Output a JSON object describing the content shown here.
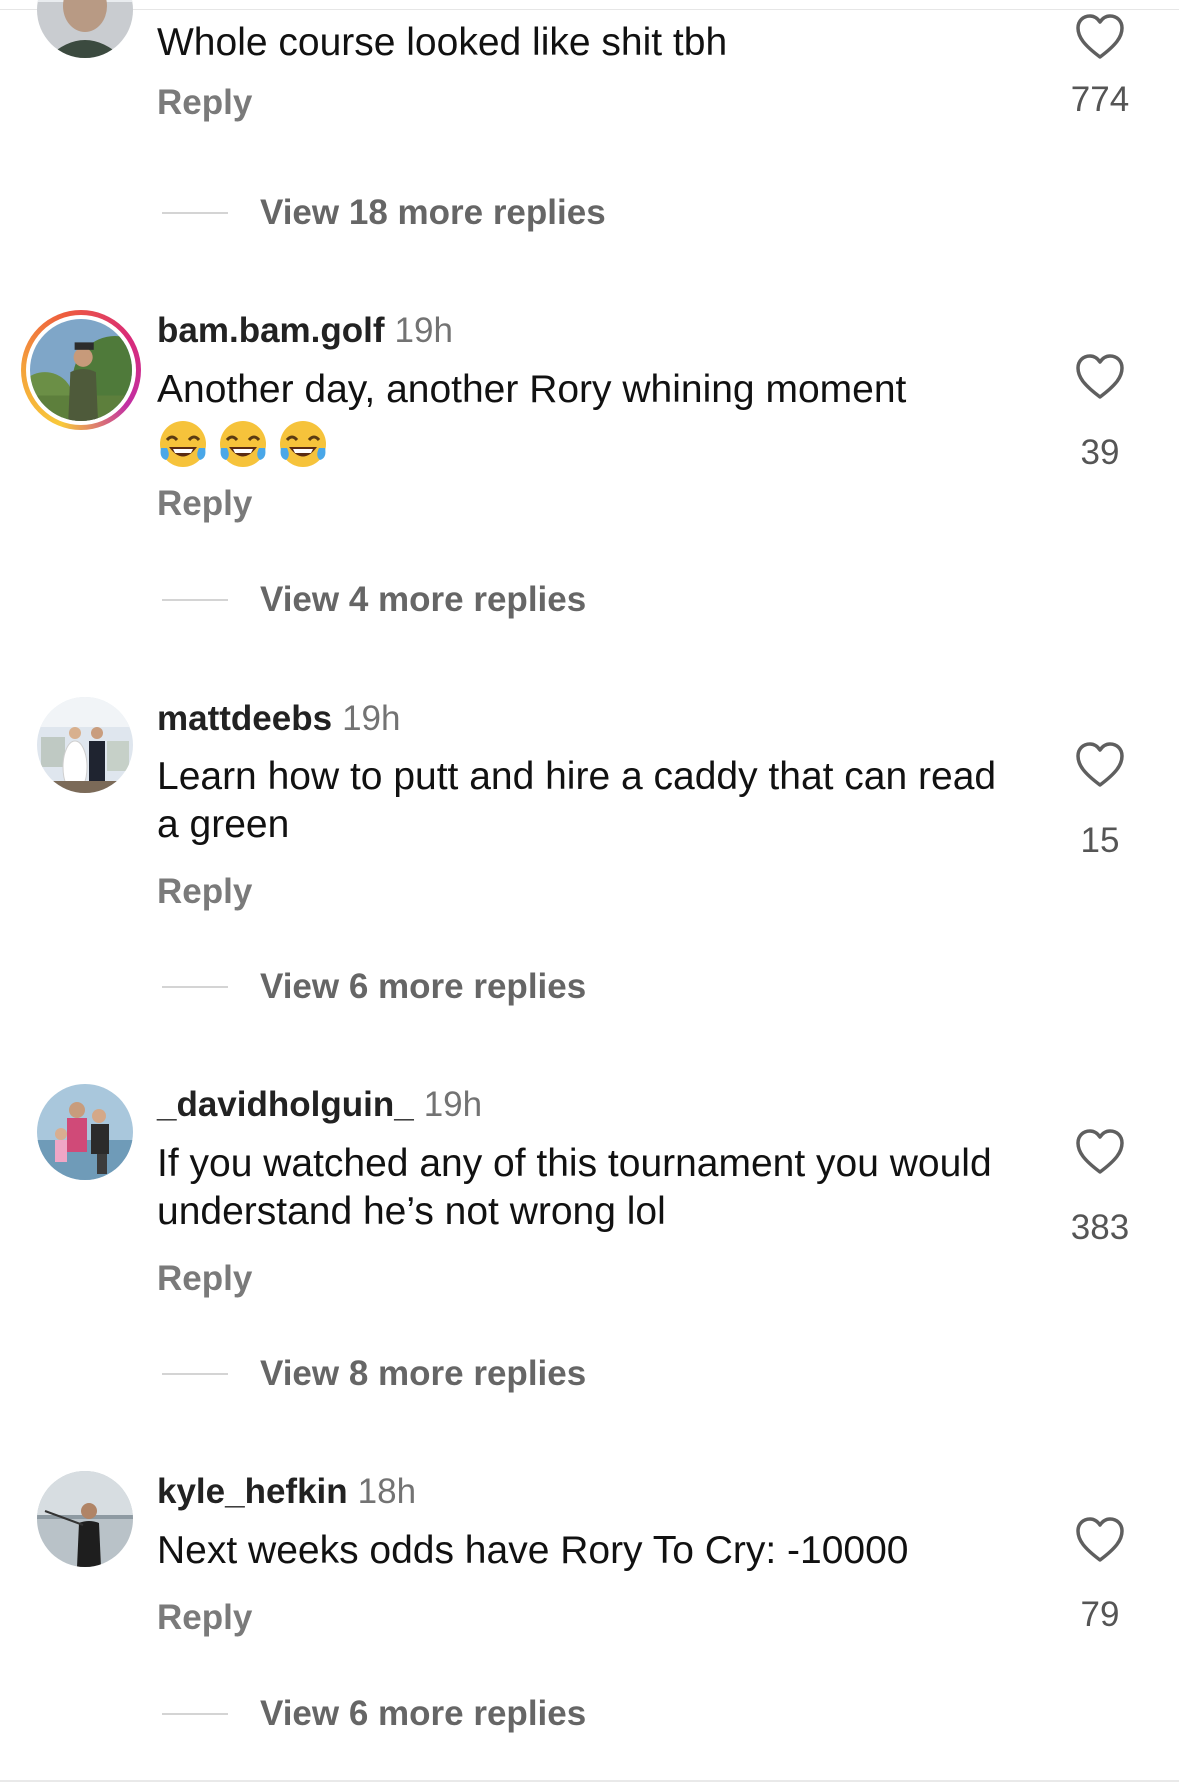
{
  "comments": [
    {
      "username": "",
      "time": "",
      "text": "Whole course looked like shit tbh",
      "reply_label": "Reply",
      "likes": "774",
      "view_more": "View 18 more replies"
    },
    {
      "username": "bam.bam.golf",
      "time": "19h",
      "text": "Another day, another Rory whining moment",
      "emoji": "laughing-tears-emoji",
      "reply_label": "Reply",
      "likes": "39",
      "view_more": "View 4 more replies"
    },
    {
      "username": "mattdeebs",
      "time": "19h",
      "text": "Learn how to putt and hire a caddy that can read a green",
      "reply_label": "Reply",
      "likes": "15",
      "view_more": "View 6 more replies"
    },
    {
      "username": "_davidholguin_",
      "time": "19h",
      "text": "If you watched any of this tournament you would understand he’s not wrong lol",
      "reply_label": "Reply",
      "likes": "383",
      "view_more": "View 8 more replies"
    },
    {
      "username": "kyle_hefkin",
      "time": "18h",
      "text": "Next weeks odds have Rory To Cry: -10000",
      "reply_label": "Reply",
      "likes": "79",
      "view_more": "View 6 more replies"
    }
  ],
  "icons": {
    "like": "heart-outline-icon"
  },
  "colors": {
    "text": "#111111",
    "muted": "#737373",
    "story_ring_start": "#f8c93a",
    "story_ring_end": "#c12fa4"
  }
}
